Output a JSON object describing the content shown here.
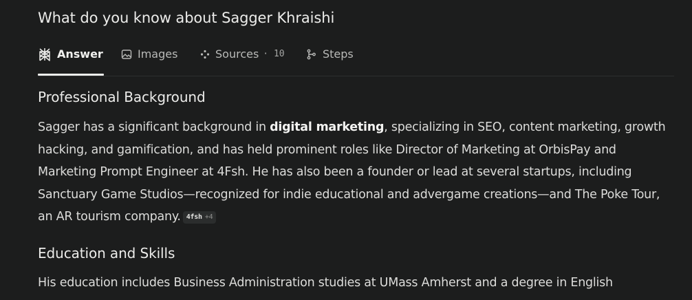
{
  "query": {
    "title": "What do you know about Sagger Khraishi"
  },
  "tabs": [
    {
      "label": "Answer",
      "icon": "perplexity-logo-icon",
      "active": true
    },
    {
      "label": "Images",
      "icon": "image-icon",
      "active": false
    },
    {
      "label": "Sources",
      "icon": "sources-icon",
      "count": "· 10",
      "active": false
    },
    {
      "label": "Steps",
      "icon": "steps-icon",
      "active": false
    }
  ],
  "answer": {
    "section1": {
      "heading": "Professional Background",
      "text_before": "Sagger has a significant background in ",
      "bold": "digital marketing",
      "text_after": ", specializing in SEO, content marketing, growth hacking, and gamification, and has held prominent roles like Director of Marketing at OrbisPay and Marketing Prompt Engineer at 4Fsh. He has also been a founder or lead at several startups, including Sanctuary Game Studios—recognized for indie educational and advergame creations—and The Poke Tour, an AR tourism company.",
      "citation": {
        "source": "4fsh",
        "more": "+4"
      }
    },
    "section2": {
      "heading": "Education and Skills",
      "text": "His education includes Business Administration studies at UMass Amherst and a degree in English"
    }
  },
  "colors": {
    "background": "#1c1d1d",
    "text": "#dcdcda",
    "muted": "#b9bab8",
    "divider": "#2d2f2f"
  }
}
